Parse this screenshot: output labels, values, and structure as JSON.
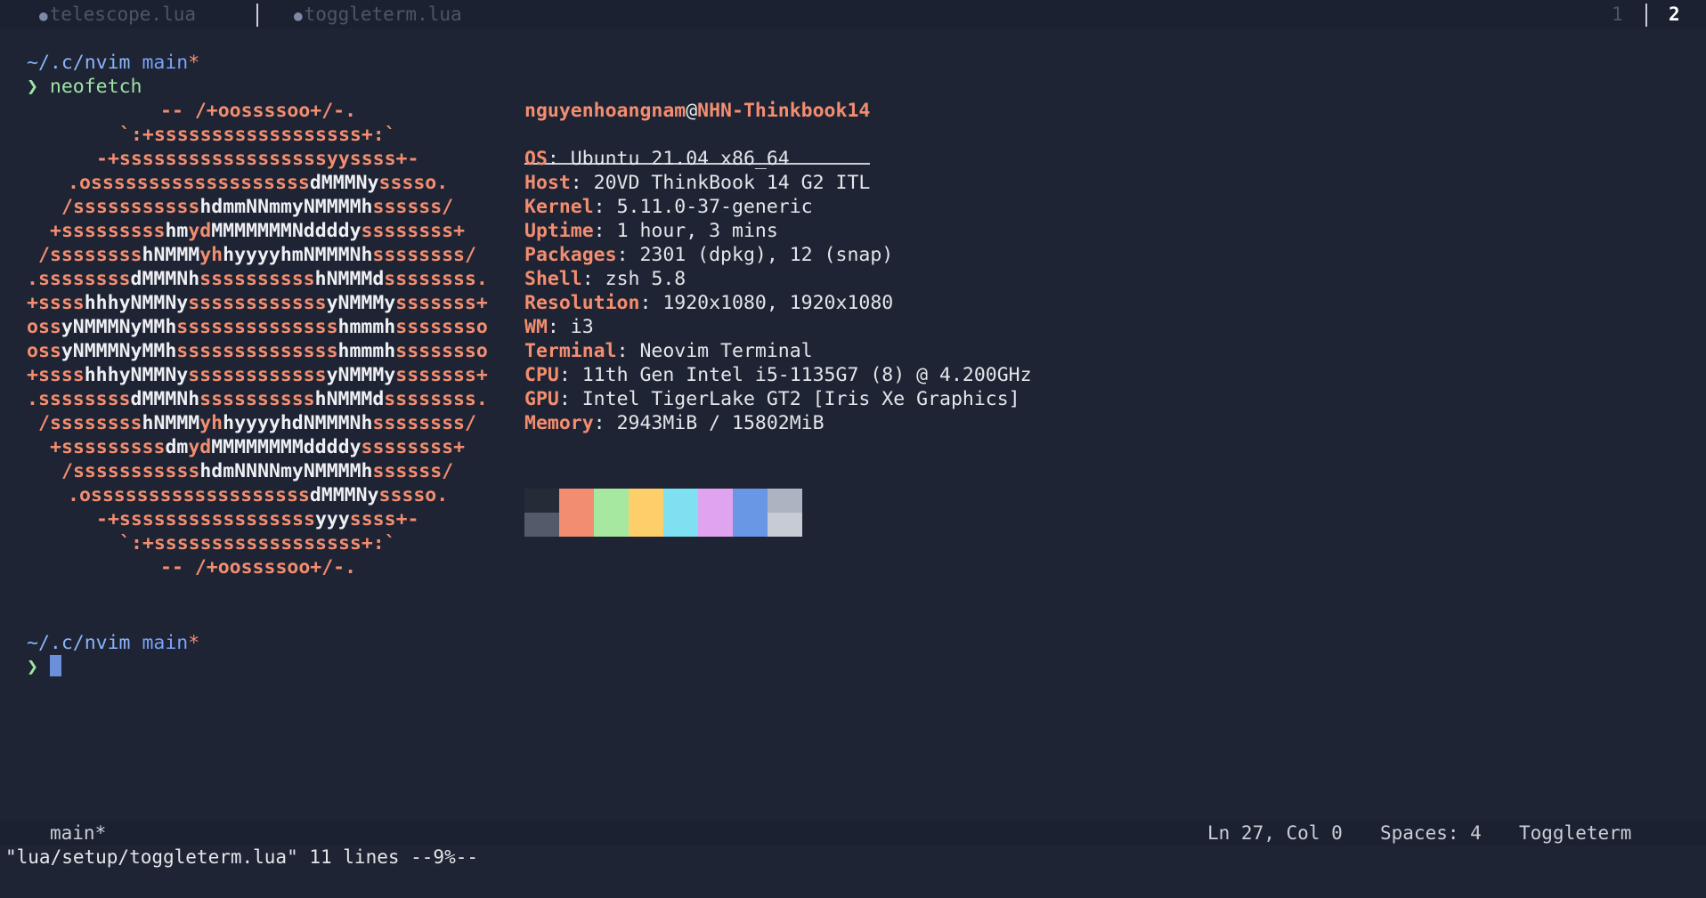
{
  "tabline": {
    "tabs": [
      {
        "label": "telescope.lua",
        "icon": "lua-icon"
      },
      {
        "label": "toggleterm.lua",
        "icon": "lua-icon"
      }
    ],
    "tab_numbers": [
      "1",
      "2"
    ],
    "active_tab_number": "2"
  },
  "terminal": {
    "prompt_symbol": "❯",
    "first_prompt": {
      "cwd": "~/.c/nvim",
      "branch": "main",
      "dirty": "*",
      "command": "neofetch"
    },
    "second_prompt": {
      "cwd": "~/.c/nvim",
      "branch": "main",
      "dirty": "*",
      "command": ""
    }
  },
  "neofetch": {
    "user": "nguyenhoangnam",
    "at": "@",
    "host": "NHN-Thinkbook14",
    "info": [
      {
        "label": "OS",
        "value": "Ubuntu 21.04 x86_64"
      },
      {
        "label": "Host",
        "value": "20VD ThinkBook 14 G2 ITL"
      },
      {
        "label": "Kernel",
        "value": "5.11.0-37-generic"
      },
      {
        "label": "Uptime",
        "value": "1 hour, 3 mins"
      },
      {
        "label": "Packages",
        "value": "2301 (dpkg), 12 (snap)"
      },
      {
        "label": "Shell",
        "value": "zsh 5.8"
      },
      {
        "label": "Resolution",
        "value": "1920x1080, 1920x1080"
      },
      {
        "label": "WM",
        "value": "i3"
      },
      {
        "label": "Terminal",
        "value": "Neovim Terminal"
      },
      {
        "label": "CPU",
        "value": "11th Gen Intel i5-1135G7 (8) @ 4.200GHz"
      },
      {
        "label": "GPU",
        "value": "Intel TigerLake GT2 [Iris Xe Graphics]"
      },
      {
        "label": "Memory",
        "value": "2943MiB / 15802MiB"
      }
    ],
    "palette_top": [
      "#262b38",
      "#f38d70",
      "#a7e8a0",
      "#fdcf6b",
      "#7ee0f0",
      "#dfa3ef",
      "#6a96e6",
      "#adb3c0"
    ],
    "palette_bottom": [
      "#535a69",
      "#f38d70",
      "#a7e8a0",
      "#fdcf6b",
      "#7ee0f0",
      "#dfa3ef",
      "#6a96e6",
      "#c7cbd4"
    ],
    "logo": [
      [
        [
          "s",
          "-- /+oossssoo+/-."
        ]
      ],
      [
        [
          "s",
          "`:+ssssssssssssssssss+:`"
        ]
      ],
      [
        [
          "s",
          "-+ssssssssssssssssssyyssss+-"
        ]
      ],
      [
        [
          "s",
          ".osssssssssssssssssss"
        ],
        [
          "w",
          "dMMMNy"
        ],
        [
          "s",
          "sssso."
        ]
      ],
      [
        [
          "s",
          "/sssssssssss"
        ],
        [
          "w",
          "hdmmNNmmyNMMMMh"
        ],
        [
          "s",
          "ssssss/"
        ]
      ],
      [
        [
          "s",
          "+sssssssss"
        ],
        [
          "w",
          "hm"
        ],
        [
          "s",
          "yd"
        ],
        [
          "w",
          "MMMMMMMNddddy"
        ],
        [
          "s",
          "ssssssss+"
        ]
      ],
      [
        [
          "s",
          "/ssssssss"
        ],
        [
          "w",
          "hNMMM"
        ],
        [
          "s",
          "yh"
        ],
        [
          "w",
          "hyyyyhmNMMMNh"
        ],
        [
          "s",
          "ssssssss/"
        ]
      ],
      [
        [
          "s",
          ".ssssssss"
        ],
        [
          "w",
          "dMMMNh"
        ],
        [
          "s",
          "ssssssssss"
        ],
        [
          "w",
          "hNMMMd"
        ],
        [
          "s",
          "ssssssss."
        ]
      ],
      [
        [
          "s",
          "+ssss"
        ],
        [
          "w",
          "hhhyNMMNy"
        ],
        [
          "s",
          "ssssssssssss"
        ],
        [
          "w",
          "yNMMMy"
        ],
        [
          "s",
          "sssssss+"
        ]
      ],
      [
        [
          "s",
          "oss"
        ],
        [
          "w",
          "yNMMMNyMMh"
        ],
        [
          "s",
          "ssssssssssssss"
        ],
        [
          "w",
          "hmmmh"
        ],
        [
          "s",
          "ssssssso"
        ]
      ],
      [
        [
          "s",
          "oss"
        ],
        [
          "w",
          "yNMMMNyMMh"
        ],
        [
          "s",
          "ssssssssssssss"
        ],
        [
          "w",
          "hmmmh"
        ],
        [
          "s",
          "ssssssso"
        ]
      ],
      [
        [
          "s",
          "+ssss"
        ],
        [
          "w",
          "hhhyNMMNy"
        ],
        [
          "s",
          "ssssssssssss"
        ],
        [
          "w",
          "yNMMMy"
        ],
        [
          "s",
          "sssssss+"
        ]
      ],
      [
        [
          "s",
          ".ssssssss"
        ],
        [
          "w",
          "dMMMNh"
        ],
        [
          "s",
          "ssssssssss"
        ],
        [
          "w",
          "hNMMMd"
        ],
        [
          "s",
          "ssssssss."
        ]
      ],
      [
        [
          "s",
          "/ssssssss"
        ],
        [
          "w",
          "hNMMM"
        ],
        [
          "s",
          "yh"
        ],
        [
          "w",
          "hyyyyhdNMMMNh"
        ],
        [
          "s",
          "ssssssss/"
        ]
      ],
      [
        [
          "s",
          "+sssssssss"
        ],
        [
          "w",
          "dm"
        ],
        [
          "s",
          "yd"
        ],
        [
          "w",
          "MMMMMMMMddddy"
        ],
        [
          "s",
          "ssssssss+"
        ]
      ],
      [
        [
          "s",
          "/sssssssssss"
        ],
        [
          "w",
          "hdmNNNNmyNMMMMh"
        ],
        [
          "s",
          "ssssss/"
        ]
      ],
      [
        [
          "s",
          ".osssssssssssssssssss"
        ],
        [
          "w",
          "dMMMNy"
        ],
        [
          "s",
          "sssso."
        ]
      ],
      [
        [
          "s",
          "-+sssssssssssssssss"
        ],
        [
          "w",
          "yyy"
        ],
        [
          "s",
          "ssss+-"
        ]
      ],
      [
        [
          "s",
          "`:+ssssssssssssssssss+:`"
        ]
      ],
      [
        [
          "s",
          "-- /+oossssoo+/-."
        ]
      ]
    ]
  },
  "statusbar": {
    "branch_icon": "git-branch-icon",
    "branch": "main*",
    "position": "Ln 27, Col 0",
    "spaces": "Spaces: 4",
    "mode": "Toggleterm",
    "smiley_icon": "smiley-icon"
  },
  "cmdline": "\"lua/setup/toggleterm.lua\" 11 lines --9%--"
}
